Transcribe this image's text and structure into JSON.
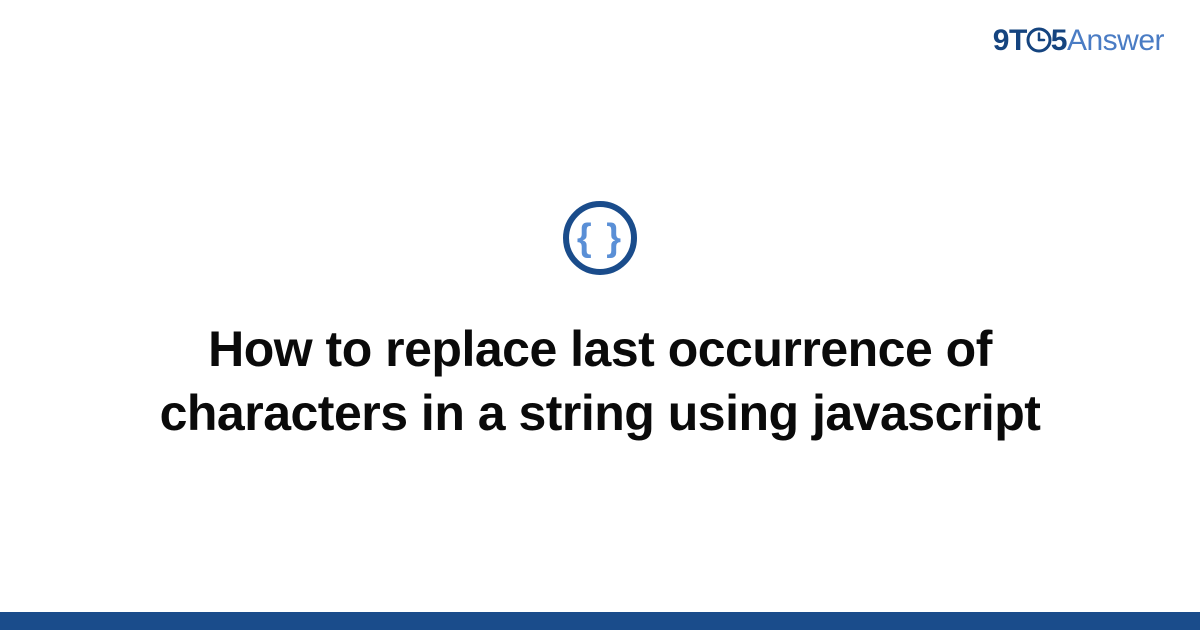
{
  "brand": {
    "nine": "9",
    "t": "T",
    "five": "5",
    "answer": "Answer"
  },
  "badge": {
    "glyph": "{ }"
  },
  "title": "How to replace last occurrence of characters in a string using javascript",
  "colors": {
    "brand_dark": "#1a4c8b",
    "brand_light": "#4a7cc4",
    "badge_glyph": "#5a8fd6",
    "text": "#0a0a0a"
  }
}
